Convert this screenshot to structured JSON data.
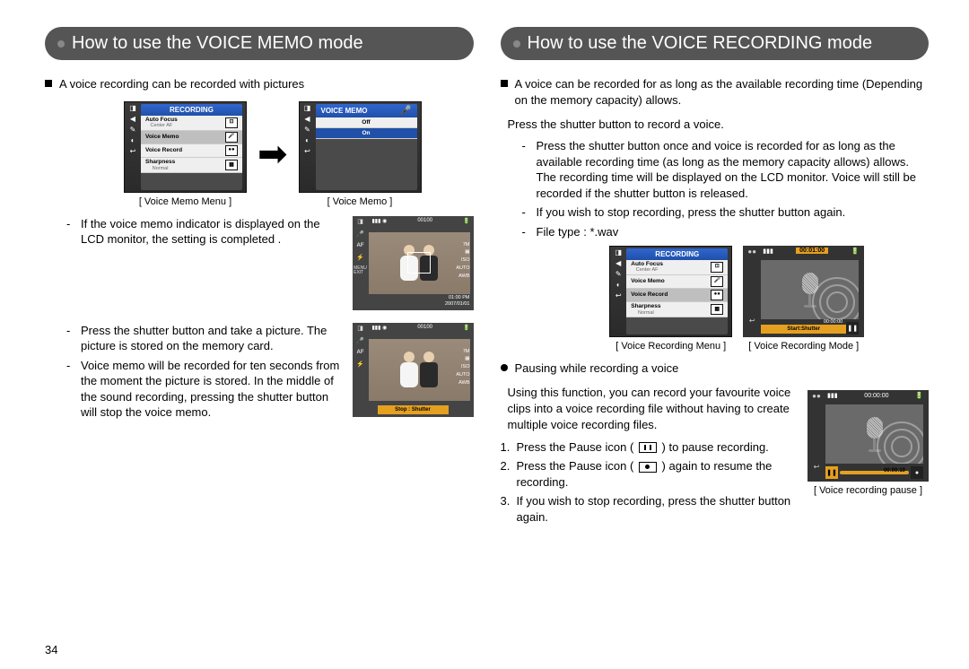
{
  "page_number": "34",
  "left": {
    "header": "How to use the VOICE MEMO mode",
    "intro": "A voice recording can be recorded with pictures",
    "caption_menu": "[ Voice Memo Menu ]",
    "caption_vm": "[ Voice Memo ]",
    "p1": "If the voice memo indicator is displayed on the LCD monitor, the setting is completed .",
    "p2": "Press the shutter button and take a picture. The picture is stored on the memory card.",
    "p3": "Voice memo will be recorded for ten seconds from the moment the picture is stored. In the middle of the sound recording, pressing the shutter button will stop the voice memo.",
    "menu": {
      "title": "RECORDING",
      "row1": "Auto Focus",
      "row1sub": "Center AF",
      "row2": "Voice Memo",
      "row3": "Voice Record",
      "row4": "Sharpness",
      "row4sub": "Normal"
    },
    "vm_menu": {
      "title": "VOICE MEMO",
      "opt1": "Off",
      "opt2": "On"
    },
    "photo_info": {
      "count": "00100",
      "bottom_time": "01:00 PM",
      "bottom_date": "2007/01/01",
      "size": "7M",
      "iso": "ISO",
      "auto": "AUTO",
      "awb": "AWB",
      "af": "AF",
      "stop_label": "Stop : Shutter"
    }
  },
  "right": {
    "header": "How to use the VOICE RECORDING mode",
    "intro": "A voice can be recorded for as long as the available recording time (Depending on the memory capacity) allows.",
    "press": "Press the shutter button to record a voice.",
    "d1": "Press the shutter button once and voice is recorded for as long as the available recording time (as long as the memory capacity allows) allows. The recording time will be displayed on the LCD monitor. Voice will still be recorded if the shutter button is released.",
    "d2": "If you wish to stop recording, press the shutter button again.",
    "d3": "File type : *.wav",
    "caption_menu": "[ Voice Recording Menu ]",
    "caption_mode": "[ Voice Recording Mode ]",
    "caption_pause": "[ Voice recording pause ]",
    "pausing_header": "Pausing while recording a voice",
    "pausing_intro": "Using this function, you can record your favourite voice clips into a voice recording file without having to create multiple voice recording files.",
    "n1a": "Press the Pause icon (",
    "n1b": ") to pause recording.",
    "n2a": "Press the Pause icon (",
    "n2b": ") again to resume the recording.",
    "n3": "If you wish to stop recording, press the shutter button again.",
    "audio_time_top": "00:01:00",
    "audio_time_bottom": "00:00:00",
    "start_shutter": "Start:Shutter",
    "pause_top": "00:00:00",
    "pause_elapsed": "00:00:10"
  }
}
